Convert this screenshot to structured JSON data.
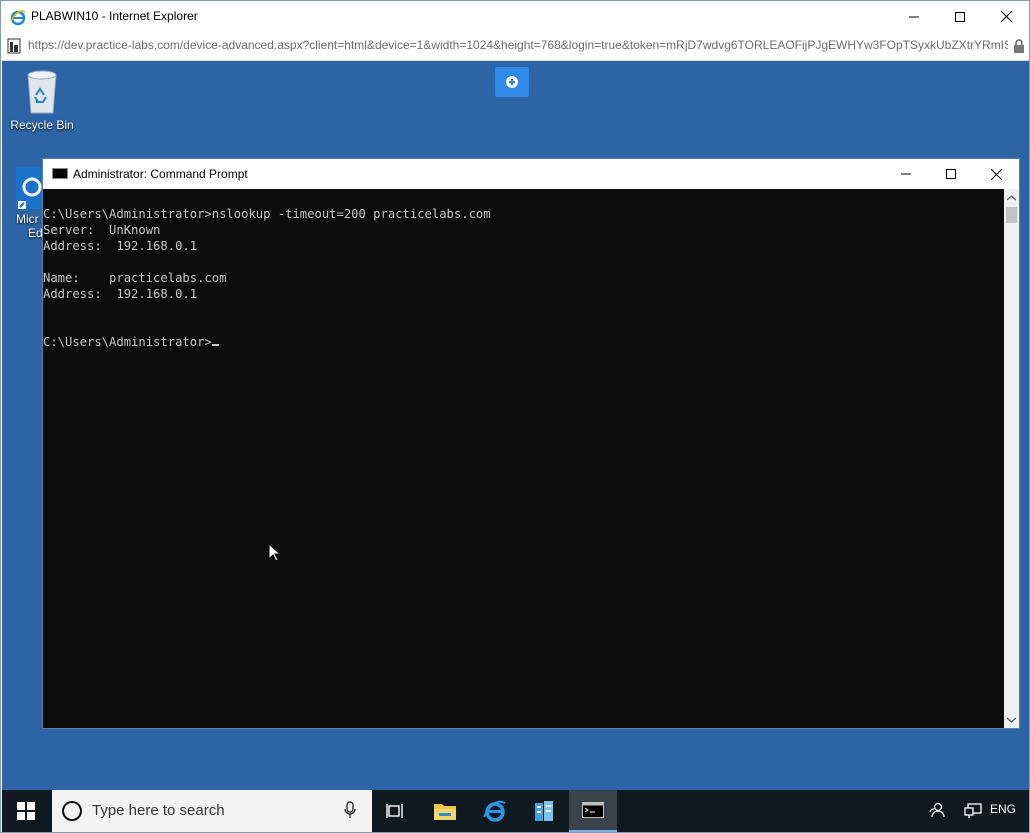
{
  "browser": {
    "window_title": "PLABWIN10 - Internet Explorer",
    "address_url": "https://dev.practice-labs.com/device-advanced.aspx?client=html&device=1&width=1024&height=768&login=true&token=mRjD7wdvg6TORLEAOFijPJgEWHYw3FOpTSyxkUbZXtrYRmIS"
  },
  "desktop": {
    "icons": [
      {
        "label": "Recycle Bin",
        "icon": "recycle-bin-icon"
      },
      {
        "label": "Micr",
        "label2": "Ed",
        "icon": "microsoft-edge-icon"
      }
    ]
  },
  "cmd": {
    "title": "Administrator: Command Prompt",
    "lines": [
      "C:\\Users\\Administrator>nslookup -timeout=200 practicelabs.com",
      "Server:  UnKnown",
      "Address:  192.168.0.1",
      "",
      "Name:    practicelabs.com",
      "Address:  192.168.0.1",
      "",
      ""
    ],
    "prompt": "C:\\Users\\Administrator>"
  },
  "taskbar": {
    "search_placeholder": "Type here to search",
    "language": "ENG",
    "apps": [
      "task-view-icon",
      "file-explorer-icon",
      "internet-explorer-icon",
      "server-manager-icon",
      "command-prompt-icon"
    ]
  },
  "colors": {
    "desktop": "#2c64a6",
    "console_bg": "#0c0c0c",
    "console_text": "#c7c7c7",
    "taskbar": "#101820"
  }
}
